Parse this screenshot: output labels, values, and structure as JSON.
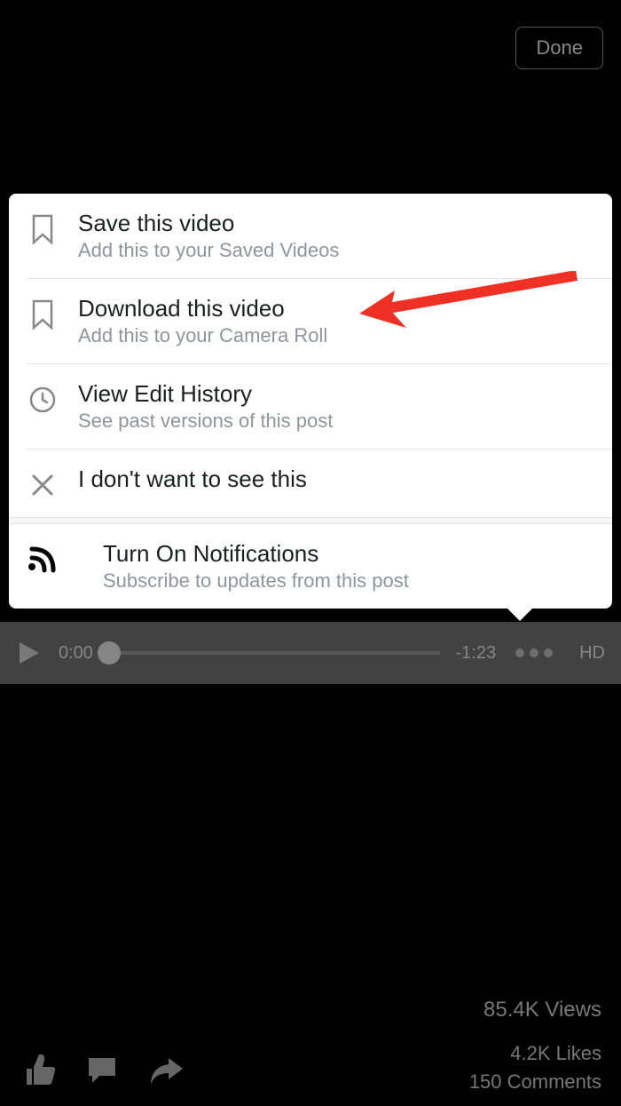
{
  "header": {
    "done_label": "Done"
  },
  "menu": {
    "items": [
      {
        "title": "Save this video",
        "subtitle": "Add this to your Saved Videos"
      },
      {
        "title": "Download this video",
        "subtitle": "Add this to your Camera Roll"
      },
      {
        "title": "View Edit History",
        "subtitle": "See past versions of this post"
      },
      {
        "title": "I don't want to see this",
        "subtitle": ""
      },
      {
        "title": "Turn On Notifications",
        "subtitle": "Subscribe to updates from this post"
      }
    ]
  },
  "player": {
    "current_time": "0:00",
    "remaining_time": "-1:23",
    "hd_label": "HD"
  },
  "footer": {
    "views": "85.4K Views",
    "likes": "4.2K Likes",
    "comments": "150 Comments"
  }
}
